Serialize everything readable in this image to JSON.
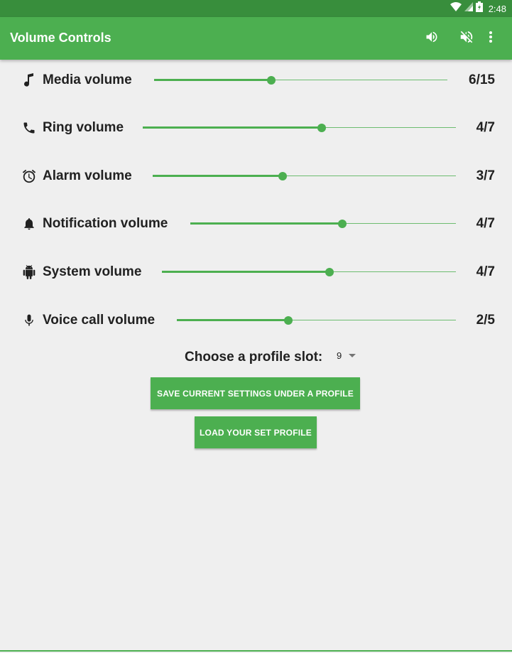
{
  "status_bar": {
    "time": "2:48",
    "icons": [
      "wifi-icon",
      "signal-icon",
      "battery-icon"
    ]
  },
  "app_bar": {
    "title": "Volume Controls",
    "actions": [
      {
        "name": "volume-up-icon",
        "label": "Volume on"
      },
      {
        "name": "volume-off-icon",
        "label": "Mute"
      },
      {
        "name": "more-vert-icon",
        "label": "More options"
      }
    ]
  },
  "accent_color": "#4caf50",
  "volumes": [
    {
      "icon": "music-note-icon",
      "label": "Media volume",
      "value": "6/15",
      "fraction": 0.4
    },
    {
      "icon": "phone-icon",
      "label": "Ring volume",
      "value": "4/7",
      "fraction": 0.571
    },
    {
      "icon": "alarm-icon",
      "label": "Alarm volume",
      "value": "3/7",
      "fraction": 0.429
    },
    {
      "icon": "bell-icon",
      "label": "Notification volume",
      "value": "4/7",
      "fraction": 0.571
    },
    {
      "icon": "android-icon",
      "label": "System volume",
      "value": "4/7",
      "fraction": 0.571
    },
    {
      "icon": "microphone-icon",
      "label": "Voice call volume",
      "value": "2/5",
      "fraction": 0.4
    }
  ],
  "profile": {
    "label": "Choose a profile slot:",
    "selected": "9",
    "save_button": "SAVE CURRENT SETTINGS UNDER A PROFILE",
    "load_button": "LOAD YOUR SET PROFILE"
  }
}
